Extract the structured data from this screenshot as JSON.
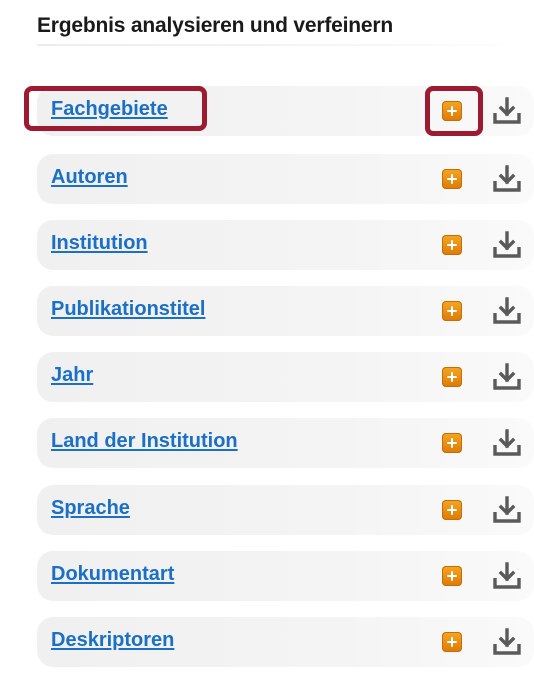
{
  "panel": {
    "title": "Ergebnis analysieren und verfeinern"
  },
  "facets": [
    {
      "label": "Fachgebiete",
      "expand_icon": "plus-icon",
      "download_icon": "download-icon"
    },
    {
      "label": "Autoren",
      "expand_icon": "plus-icon",
      "download_icon": "download-icon"
    },
    {
      "label": "Institution",
      "expand_icon": "plus-icon",
      "download_icon": "download-icon"
    },
    {
      "label": "Publikationstitel",
      "expand_icon": "plus-icon",
      "download_icon": "download-icon"
    },
    {
      "label": "Jahr",
      "expand_icon": "plus-icon",
      "download_icon": "download-icon"
    },
    {
      "label": "Land der Institution",
      "expand_icon": "plus-icon",
      "download_icon": "download-icon"
    },
    {
      "label": "Sprache",
      "expand_icon": "plus-icon",
      "download_icon": "download-icon"
    },
    {
      "label": "Dokumentart",
      "expand_icon": "plus-icon",
      "download_icon": "download-icon"
    },
    {
      "label": "Deskriptoren",
      "expand_icon": "plus-icon",
      "download_icon": "download-icon"
    }
  ],
  "colors": {
    "link": "#1a6fc6",
    "expand_button": "#e8890f",
    "download_icon": "#5a5a5a",
    "highlight_annotation": "#9c1b31",
    "row_background": "#f2f2f2"
  },
  "annotations": {
    "highlighted": [
      "facet-0-link",
      "facet-0-expand-button"
    ]
  }
}
